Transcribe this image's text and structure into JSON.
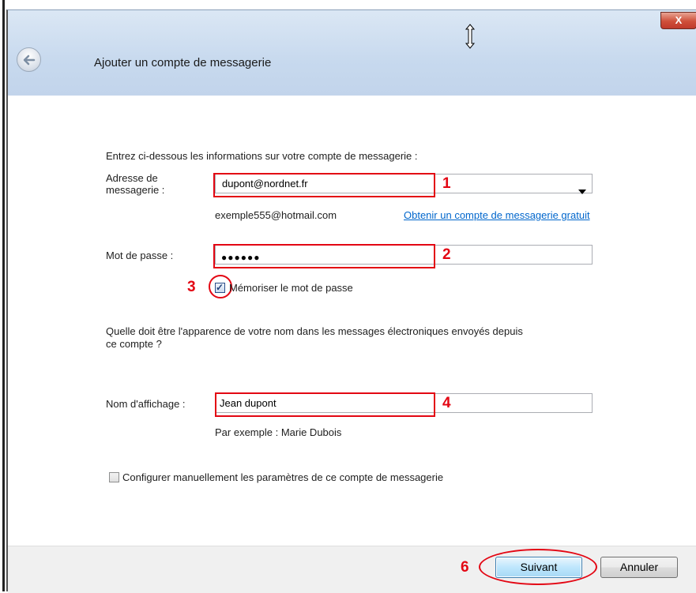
{
  "window": {
    "title": "Ajouter un compte de messagerie",
    "close_label": "X"
  },
  "form": {
    "intro": "Entrez ci-dessous les informations sur votre compte de messagerie :",
    "email_label_line1": "Adresse de",
    "email_label_line2": "messagerie :",
    "email_value": "dupont@nordnet.fr",
    "email_example": "exemple555@hotmail.com",
    "free_account_link": "Obtenir un compte de messagerie gratuit",
    "password_label": "Mot de passe :",
    "password_mask": "●●●●●●",
    "remember_password_label": "Mémoriser le mot de passe",
    "remember_password_checked": true,
    "display_question_line1": "Quelle doit être l'apparence de votre nom dans les messages électroniques envoyés depuis",
    "display_question_line2": "ce compte ?",
    "display_name_label": "Nom d'affichage :",
    "display_name_value": "Jean dupont",
    "display_example": "Par exemple : Marie Dubois",
    "manual_config_label": "Configurer manuellement les paramètres de ce compte de messagerie",
    "manual_config_checked": false
  },
  "annotations": {
    "n1": "1",
    "n2": "2",
    "n3": "3",
    "n4": "4",
    "n6": "6",
    "color": "#e30613"
  },
  "footer": {
    "next_label": "Suivant",
    "cancel_label": "Annuler"
  },
  "icons": {
    "back": "back-arrow-icon",
    "close": "close-icon",
    "cursor": "resize-vertical-cursor-icon",
    "dropdown": "chevron-down-icon",
    "check": "checkmark-icon"
  }
}
